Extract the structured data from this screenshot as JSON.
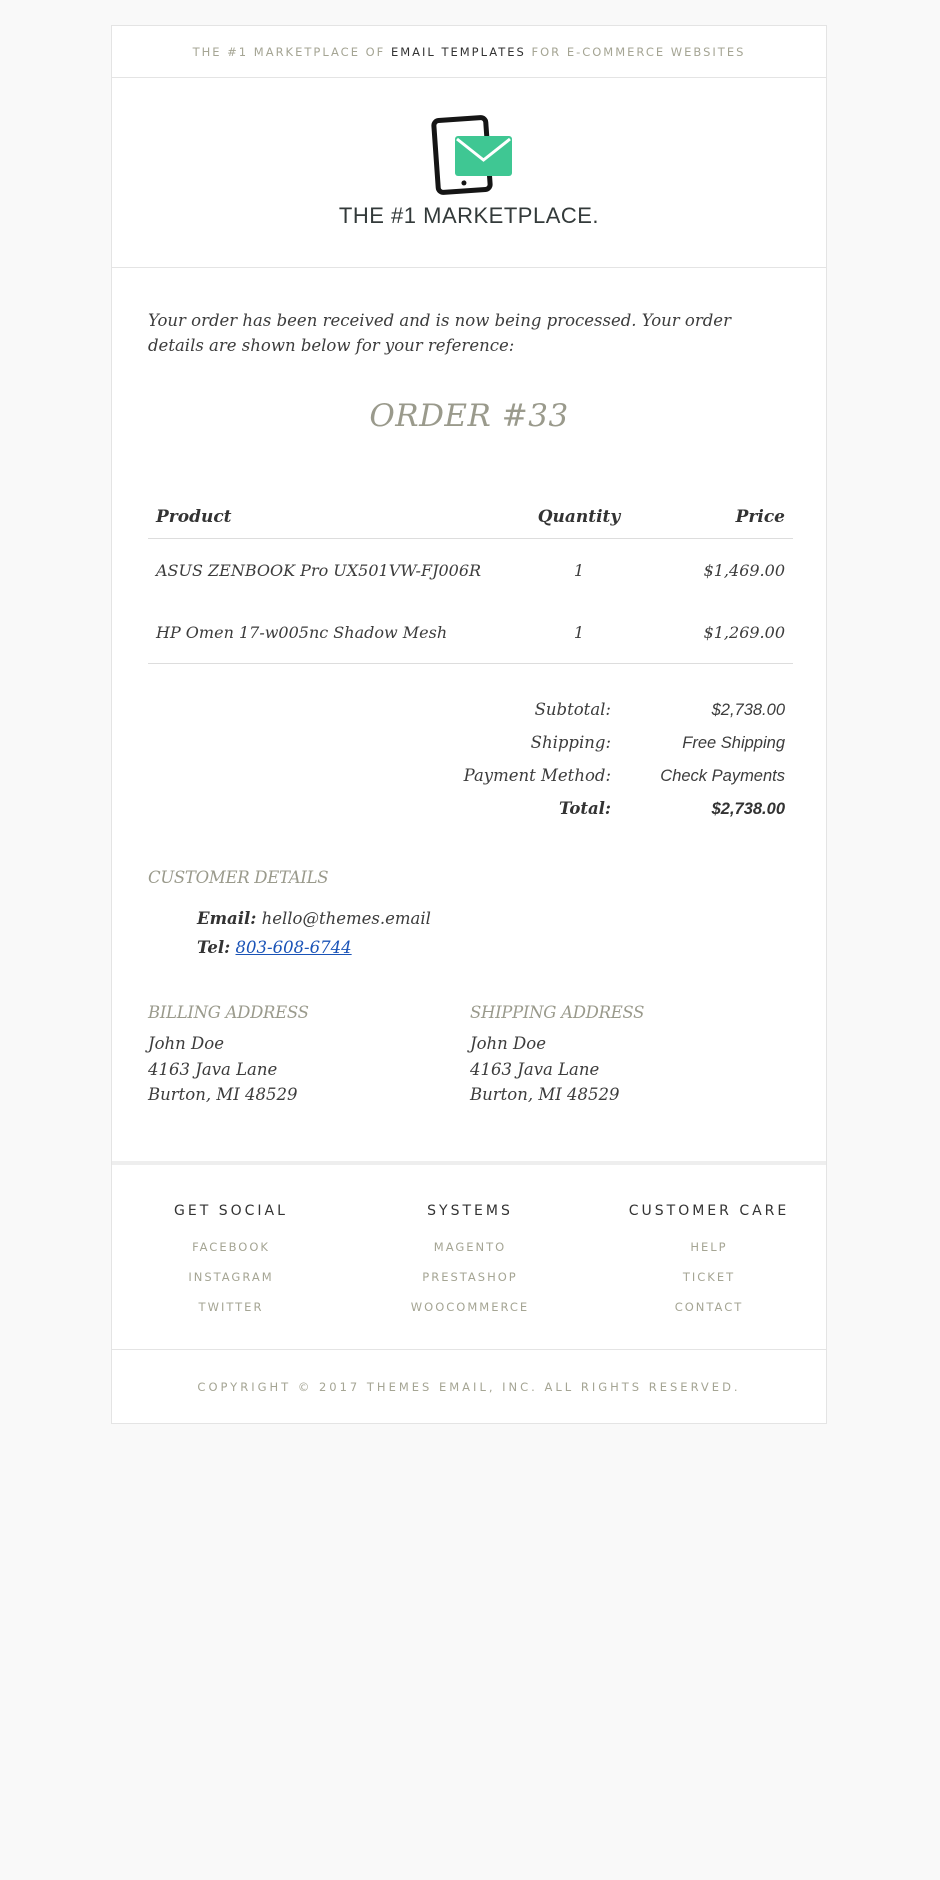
{
  "colors": {
    "accent": "#3fc793",
    "muted": "#a5a594",
    "heading_muted": "#9a9a8c",
    "text": "#3c3c3c",
    "link": "#1a53b7",
    "background": "#f9f9f9"
  },
  "topbar": {
    "pre": "THE #1 MARKETPLACE OF",
    "strong": "EMAIL TEMPLATES",
    "post": "FOR E-COMMERCE WEBSITES"
  },
  "header": {
    "logo_icon": "tablet-envelope-icon",
    "brand": "THE #1 MARKETPLACE."
  },
  "intro": "Your order has been received and is now being processed. Your order details are shown below for your reference:",
  "order_title": "ORDER #33",
  "items_table": {
    "headers": {
      "product": "Product",
      "quantity": "Quantity",
      "price": "Price"
    },
    "rows": [
      {
        "product": "ASUS ZENBOOK Pro UX501VW-FJ006R",
        "quantity": "1",
        "price": "$1,469.00"
      },
      {
        "product": "HP Omen 17-w005nc Shadow Mesh",
        "quantity": "1",
        "price": "$1,269.00"
      }
    ]
  },
  "totals": [
    {
      "label": "Subtotal:",
      "value": "$2,738.00"
    },
    {
      "label": "Shipping:",
      "value": "Free Shipping"
    },
    {
      "label": "Payment Method:",
      "value": "Check Payments"
    },
    {
      "label": "Total:",
      "value": "$2,738.00"
    }
  ],
  "customer": {
    "heading": "CUSTOMER DETAILS",
    "email_label": "Email:",
    "email": "hello@themes.email",
    "tel_label": "Tel:",
    "tel": "803-608-6744"
  },
  "billing": {
    "heading": "BILLING ADDRESS",
    "name": "John Doe",
    "street": "4163 Java Lane",
    "city": "Burton, MI 48529"
  },
  "shipping": {
    "heading": "SHIPPING ADDRESS",
    "name": "John Doe",
    "street": "4163 Java Lane",
    "city": "Burton, MI 48529"
  },
  "footer": {
    "columns": [
      {
        "title": "GET SOCIAL",
        "links": [
          "FACEBOOK",
          "INSTAGRAM",
          "TWITTER"
        ]
      },
      {
        "title": "SYSTEMS",
        "links": [
          "MAGENTO",
          "PRESTASHOP",
          "WOOCOMMERCE"
        ]
      },
      {
        "title": "CUSTOMER CARE",
        "links": [
          "HELP",
          "TICKET",
          "CONTACT"
        ]
      }
    ],
    "copyright": "COPYRIGHT © 2017 THEMES EMAIL, INC. ALL RIGHTS RESERVED."
  }
}
